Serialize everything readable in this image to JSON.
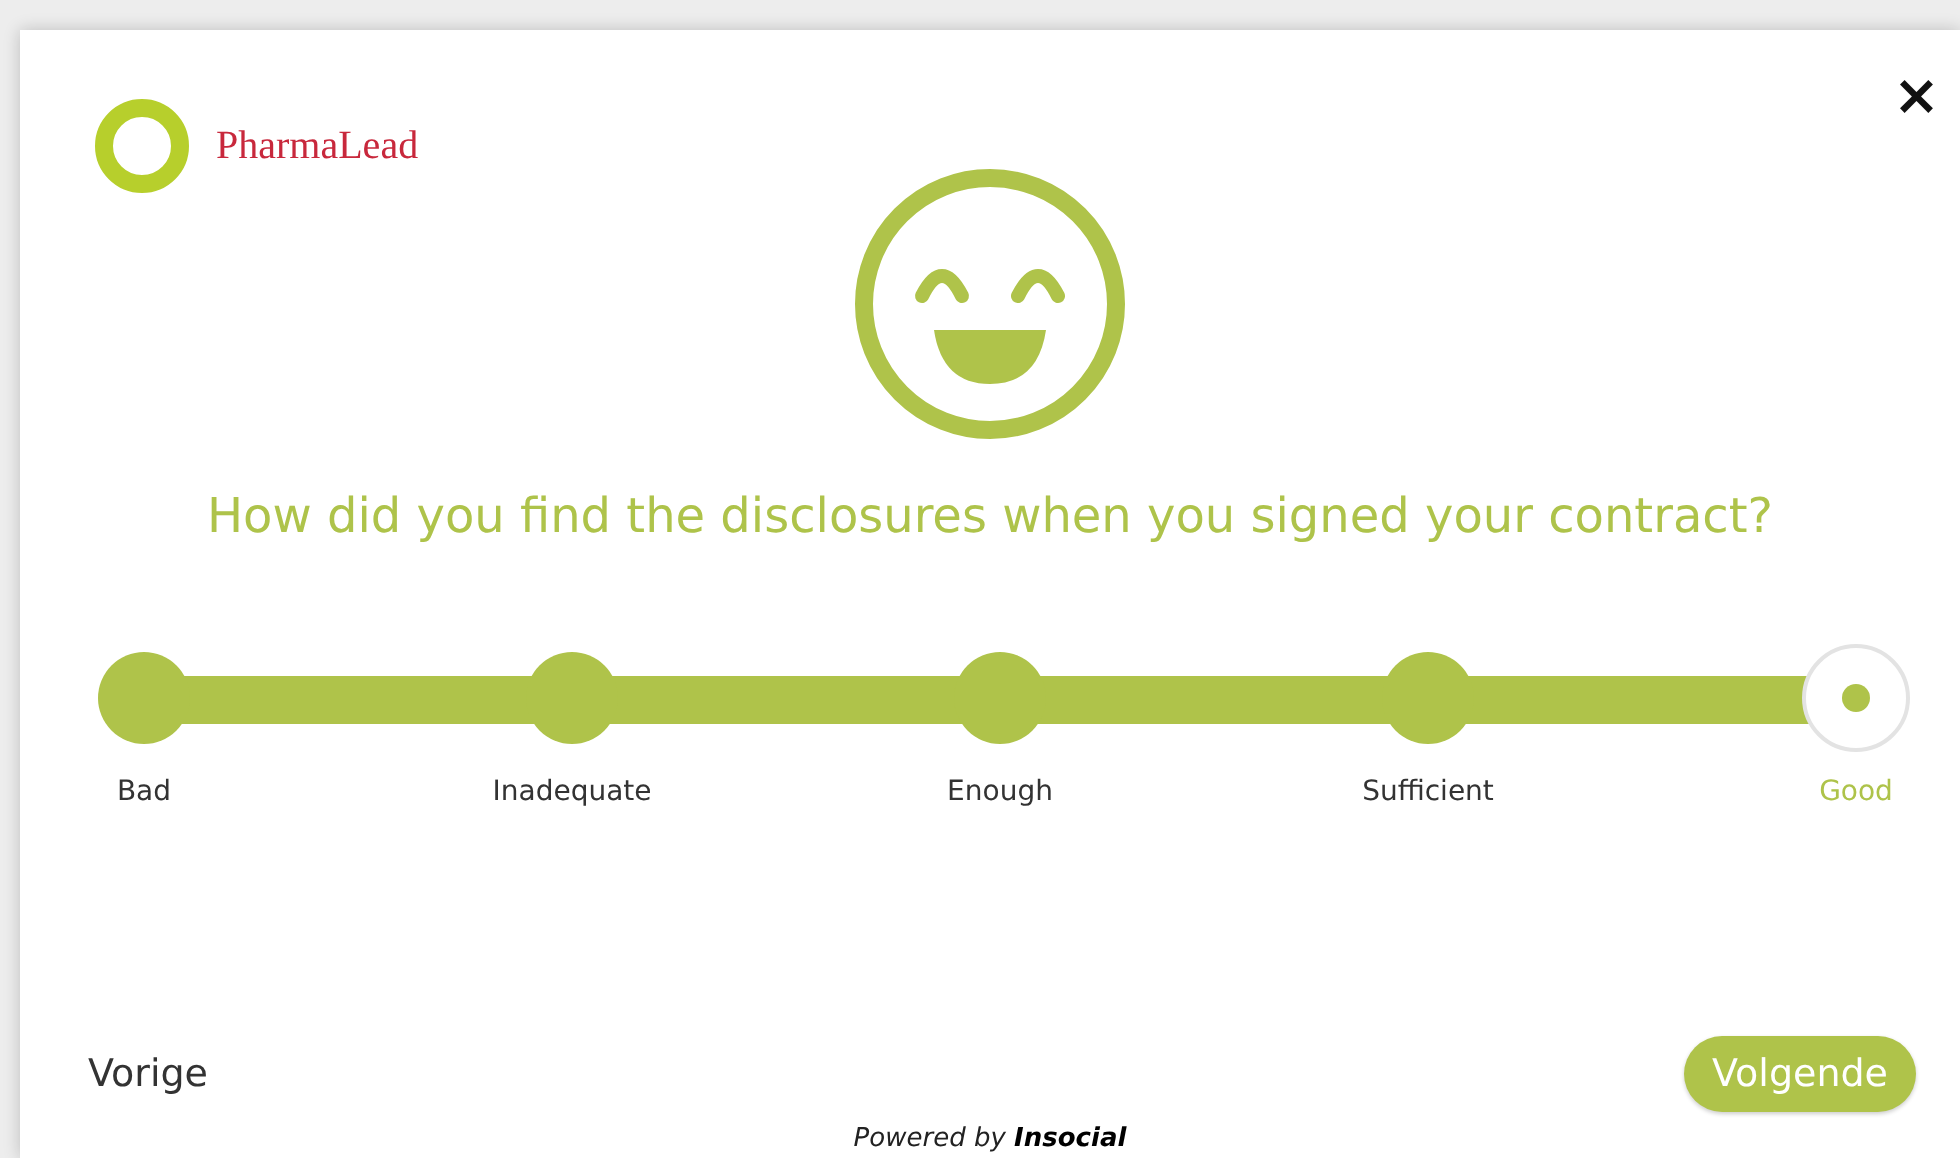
{
  "brand": {
    "name": "PharmaLead"
  },
  "close": {
    "label": "×"
  },
  "question": "How did you find the disclosures when you signed your contract?",
  "scale": [
    {
      "label": "Bad",
      "selected": false
    },
    {
      "label": "Inadequate",
      "selected": false
    },
    {
      "label": "Enough",
      "selected": false
    },
    {
      "label": "Sufficient",
      "selected": false
    },
    {
      "label": "Good",
      "selected": true
    }
  ],
  "buttons": {
    "previous": "Vorige",
    "next": "Volgende"
  },
  "footer": "Powered by **Insocial**"
}
